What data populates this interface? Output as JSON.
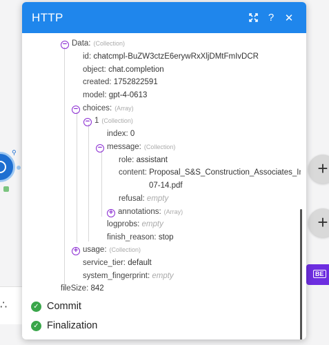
{
  "modal": {
    "title": "HTTP"
  },
  "tree": {
    "data_key": "Data:",
    "data_hint": "(Collection)",
    "id_key": "id:",
    "id_val": "chatcmpl-BuZW3ctzE6erywRxXljDMtFmIvDCR",
    "object_key": "object:",
    "object_val": "chat.completion",
    "created_key": "created:",
    "created_val": "1752822591",
    "model_key": "model:",
    "model_val": "gpt-4-0613",
    "choices_key": "choices:",
    "choices_hint": "(Array)",
    "item1_key": "1",
    "item1_hint": "(Collection)",
    "index_key": "index:",
    "index_val": "0",
    "message_key": "message:",
    "message_hint": "(Collection)",
    "role_key": "role:",
    "role_val": "assistant",
    "content_key": "content:",
    "content_val_line1": "Proposal_S&S_Construction_Associates_Inc.",
    "content_val_line2": "07-14.pdf",
    "refusal_key": "refusal:",
    "refusal_val": "empty",
    "annotations_key": "annotations:",
    "annotations_hint": "(Array)",
    "logprobs_key": "logprobs:",
    "logprobs_val": "empty",
    "finish_reason_key": "finish_reason:",
    "finish_reason_val": "stop",
    "usage_key": "usage:",
    "usage_hint": "(Collection)",
    "service_tier_key": "service_tier:",
    "service_tier_val": "default",
    "system_fingerprint_key": "system_fingerprint:",
    "system_fingerprint_val": "empty",
    "filesize_key": "fileSize:",
    "filesize_val": "842"
  },
  "status": {
    "commit": "Commit",
    "finalization": "Finalization"
  },
  "colors": {
    "header": "#1f86ec",
    "toggle": "#8a2bd2",
    "check": "#3aa64a",
    "accent_button": "#6d2ee0"
  }
}
